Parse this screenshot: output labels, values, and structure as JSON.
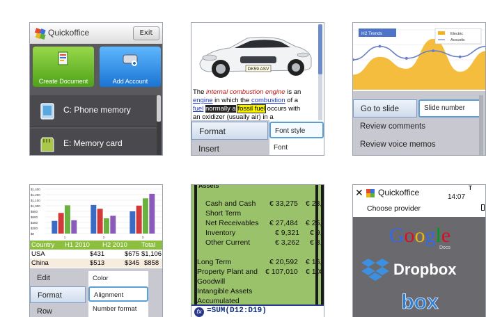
{
  "panel1": {
    "app_title": "Quickoffice",
    "exit_label": "Exit",
    "tiles": [
      {
        "label": "Create Document",
        "icon": "document-icon"
      },
      {
        "label": "Add Account",
        "icon": "hard-drive-icon"
      }
    ],
    "storage": [
      {
        "label": "C: Phone memory",
        "icon": "phone-icon"
      },
      {
        "label": "E: Memory card",
        "icon": "memory-card-icon"
      }
    ]
  },
  "panel2": {
    "plate": "DK59 ASV",
    "text": {
      "the": "The ",
      "engine_term": "internal combustion engine",
      "is_an": " is an",
      "engine_link": "engine",
      "in_which": " in which the ",
      "combustion_link": "combustion",
      "of_a": " of a",
      "fuel_link": "fuel",
      "normally": "normally a",
      "fossil_fuel": "fossil fuel",
      "occurs": " occurs with",
      "oxidizer": "an oxidizer (usually air) in a"
    },
    "menu": [
      "Format",
      "Insert"
    ],
    "submenu": [
      "Font style",
      "Font"
    ]
  },
  "panel3": {
    "chart_data": {
      "type": "area",
      "title": "H2 Trends",
      "series": [
        {
          "name": "Electric",
          "values": [
            1.0,
            2.2,
            1.4,
            3.4,
            1.2,
            2.6
          ],
          "color": "#f2b21c"
        },
        {
          "name": "Acoustic",
          "values": [
            2.0,
            2.9,
            2.1,
            2.6,
            2.2,
            2.9
          ],
          "color": "#6a7fc4"
        }
      ],
      "ylim": [
        0,
        4
      ],
      "grid": true,
      "legend": "top-right"
    },
    "menu": [
      "Go to slide",
      "Review comments",
      "Review voice memos"
    ],
    "submenu": [
      "Slide number"
    ]
  },
  "panel4": {
    "chart_data": {
      "type": "bar",
      "categories": [
        "1",
        "2",
        "3"
      ],
      "series": [
        {
          "values": [
            400,
            900,
            700
          ],
          "color": "#3c6bc6"
        },
        {
          "values": [
            650,
            780,
            880
          ],
          "color": "#cf3a3a"
        },
        {
          "values": [
            890,
            480,
            1110
          ],
          "color": "#6ab240"
        },
        {
          "values": [
            420,
            560,
            1250
          ],
          "color": "#8a5bb8"
        }
      ],
      "yticks": [
        "$1,400",
        "$1,200",
        "$1,100",
        "$1,000",
        "$800",
        "$600",
        "$400",
        "$200",
        "$0"
      ],
      "ylim": [
        0,
        1400
      ],
      "grid": true
    },
    "table": {
      "headers": [
        "Country",
        "H1 2010",
        "H2 2010",
        "Total"
      ],
      "rows": [
        [
          "USA",
          "$431",
          "$675",
          "$1,106"
        ],
        [
          "China",
          "$513",
          "$345",
          "$858"
        ]
      ]
    },
    "menu": [
      "Edit",
      "Format",
      "Row"
    ],
    "submenu": [
      "Color",
      "Alignment",
      "Number format"
    ]
  },
  "panel5": {
    "header": "Assets",
    "rows": [
      {
        "label": "Cash and Cash",
        "value": "€ 33,275",
        "extra": "€ 23,1"
      },
      {
        "label": "Short Term",
        "value": "",
        "extra": ""
      },
      {
        "label": "Net Receivables",
        "value": "€ 27,484",
        "extra": "€ 25,3"
      },
      {
        "label": "Inventory",
        "value": "€ 9,321",
        "extra": "€ 9,"
      },
      {
        "label": "Other Current",
        "value": "€ 3,262",
        "extra": "€ 3,"
      },
      {
        "label": "Long Term",
        "value": "€ 20,592",
        "extra": "€ 16,"
      },
      {
        "label": "Property Plant and",
        "value": "€ 107,010",
        "extra": "€ 108,"
      },
      {
        "label": "Goodwill",
        "value": "",
        "extra": ""
      },
      {
        "label": "Intangible Assets",
        "value": "",
        "extra": ""
      },
      {
        "label": "Accumulated",
        "value": "",
        "extra": ""
      }
    ],
    "formula": "=SUM(D12:D19)",
    "fx_label": "fx"
  },
  "panel6": {
    "close": "✕",
    "title": "Quickoffice",
    "time": "14:07",
    "signal": "T",
    "subtitle": "Choose provider",
    "providers": [
      {
        "name": "Google",
        "sub": "Docs",
        "colors": [
          "#3369e8",
          "#d50f25",
          "#eeb211",
          "#3369e8",
          "#009925",
          "#d50f25"
        ]
      },
      {
        "name": "Dropbox",
        "color": "#3d8fdf"
      },
      {
        "name": "box",
        "color": "#2f7fd4"
      }
    ]
  }
}
